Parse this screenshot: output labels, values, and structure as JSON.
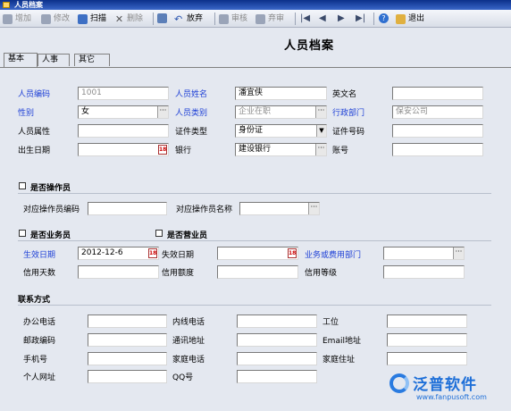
{
  "window": {
    "title": "人员档案"
  },
  "toolbar": {
    "add": "增加",
    "edit": "修改",
    "scan": "扫描",
    "delete": "删除",
    "discard": "放弃",
    "audit": "审核",
    "abandon_audit": "弃审",
    "exit": "退出"
  },
  "page_title": "人员档案",
  "tabs": [
    "基本",
    "人事",
    "其它"
  ],
  "basic": {
    "emp_code_label": "人员编码",
    "emp_code_value": "1001",
    "emp_name_label": "人员姓名",
    "emp_name_value": "潘宜侠",
    "english_name_label": "英文名",
    "english_name_value": "",
    "gender_label": "性别",
    "gender_value": "女",
    "category_label": "人员类别",
    "category_value": "企业在职",
    "dept_label": "行政部门",
    "dept_value": "保安公司",
    "attribute_label": "人员属性",
    "attribute_value": "",
    "id_type_label": "证件类型",
    "id_type_value": "身份证",
    "id_no_label": "证件号码",
    "id_no_value": "",
    "birth_label": "出生日期",
    "birth_value": "",
    "bank_label": "银行",
    "bank_value": "建设银行",
    "account_label": "账号",
    "account_value": ""
  },
  "operator": {
    "checkbox_label": "是否操作员",
    "op_code_label": "对应操作员编码",
    "op_code_value": "",
    "op_name_label": "对应操作员名称",
    "op_name_value": ""
  },
  "business": {
    "salesman_label": "是否业务员",
    "revenue_label": "是否营业员",
    "effective_label": "生效日期",
    "effective_value": "2012-12-6",
    "expire_label": "失效日期",
    "expire_value": "",
    "cost_dept_label": "业务或费用部门",
    "cost_dept_value": "",
    "credit_days_label": "信用天数",
    "credit_days_value": "",
    "credit_limit_label": "信用额度",
    "credit_limit_value": "",
    "credit_level_label": "信用等级",
    "credit_level_value": ""
  },
  "contact": {
    "section_label": "联系方式",
    "office_phone_label": "办公电话",
    "ext_phone_label": "内线电话",
    "station_label": "工位",
    "postcode_label": "邮政编码",
    "mail_addr_label": "通讯地址",
    "email_label": "Email地址",
    "mobile_label": "手机号",
    "home_phone_label": "家庭电话",
    "home_addr_label": "家庭住址",
    "homepage_label": "个人网址",
    "qq_label": "QQ号"
  },
  "logo": {
    "brand": "泛普软件",
    "url": "www.fanpusoft.com"
  },
  "colors": {
    "label_blue": "#1d3fd6",
    "titlebar": "#0b2f8a",
    "form_bg": "#e4e8f0"
  }
}
